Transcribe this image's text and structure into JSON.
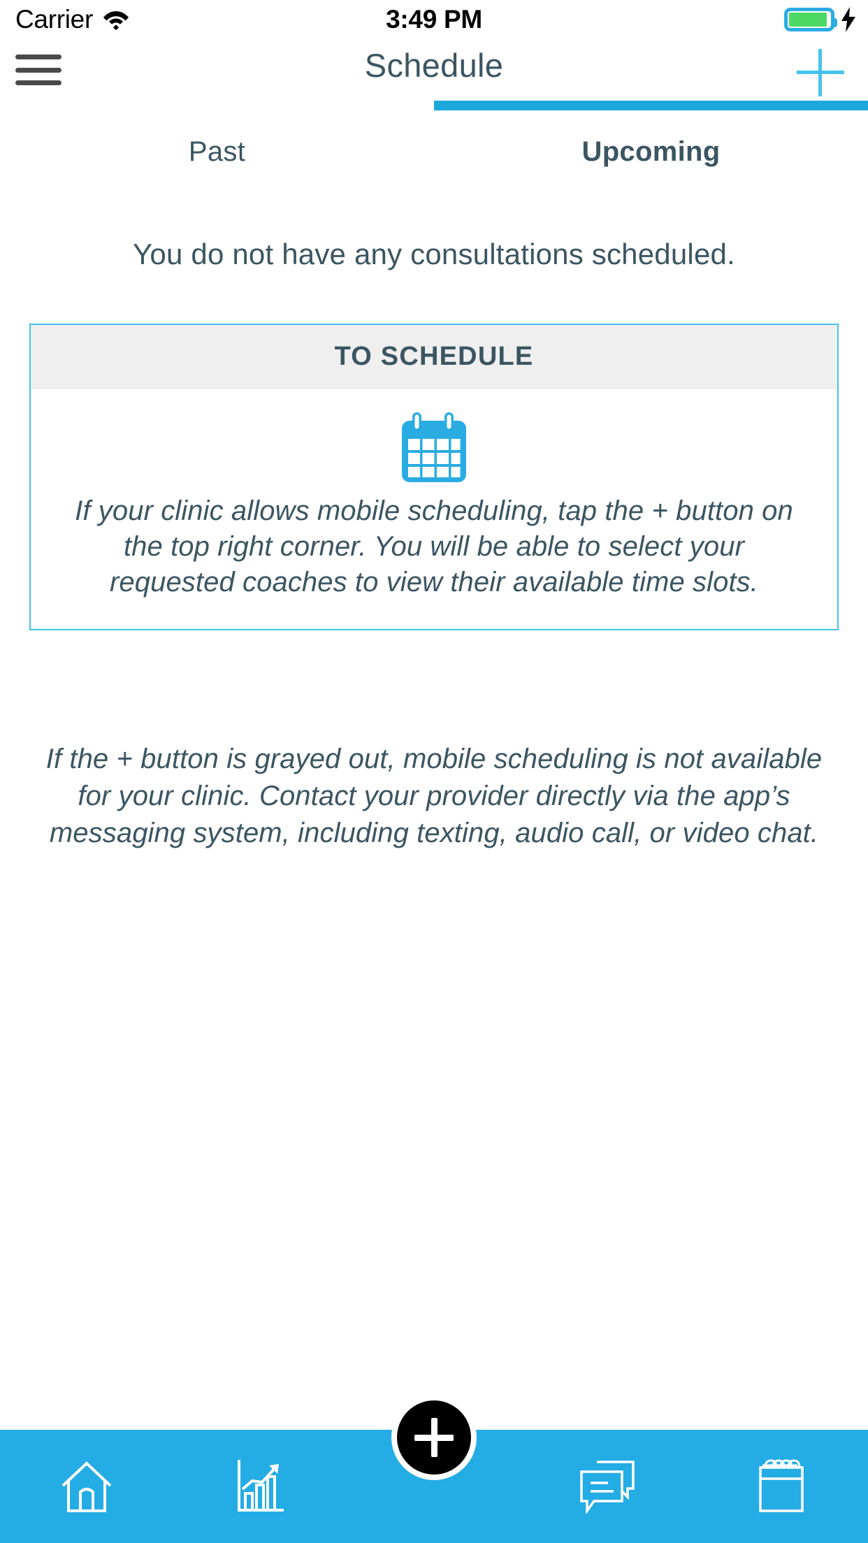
{
  "status_bar": {
    "carrier": "Carrier",
    "wifi_icon": "wifi-icon",
    "time": "3:49 PM",
    "battery_icon": "battery-icon",
    "charging_icon": "lightning-bolt-icon",
    "battery_color": "#4CD964",
    "battery_outline_color": "#2aace2"
  },
  "nav_bar": {
    "menu_icon": "hamburger-menu-icon",
    "title": "Schedule",
    "add_icon": "plus-icon",
    "title_color": "#3b5562",
    "accent_color": "#45c3ee"
  },
  "tabs": [
    {
      "label": "Past",
      "active": false
    },
    {
      "label": "Upcoming",
      "active": true
    }
  ],
  "tab_indicator_color": "#1da8dc",
  "main": {
    "empty_message": "You do not have any consultations scheduled.",
    "card": {
      "header": "TO SCHEDULE",
      "icon": "calendar-icon",
      "body_text": "If your clinic allows mobile scheduling, tap the + button on the top right corner. You will be able to select your requested coaches to view their available time slots.",
      "border_color": "#45c3ee",
      "header_bg": "#efefef"
    },
    "note_text": "If the + button is grayed out, mobile scheduling is not available for your clinic. Contact your provider directly via the app’s messaging system, including texting, audio call, or video chat."
  },
  "bottom_bar": {
    "background_color": "#24ace4",
    "items": [
      {
        "icon": "home-icon",
        "label": ""
      },
      {
        "icon": "progress-chart-icon",
        "label": ""
      },
      {
        "icon": "messages-icon",
        "label": ""
      },
      {
        "icon": "calendar-icon",
        "label": ""
      }
    ],
    "fab": {
      "icon": "plus-icon",
      "color": "#000000"
    }
  }
}
